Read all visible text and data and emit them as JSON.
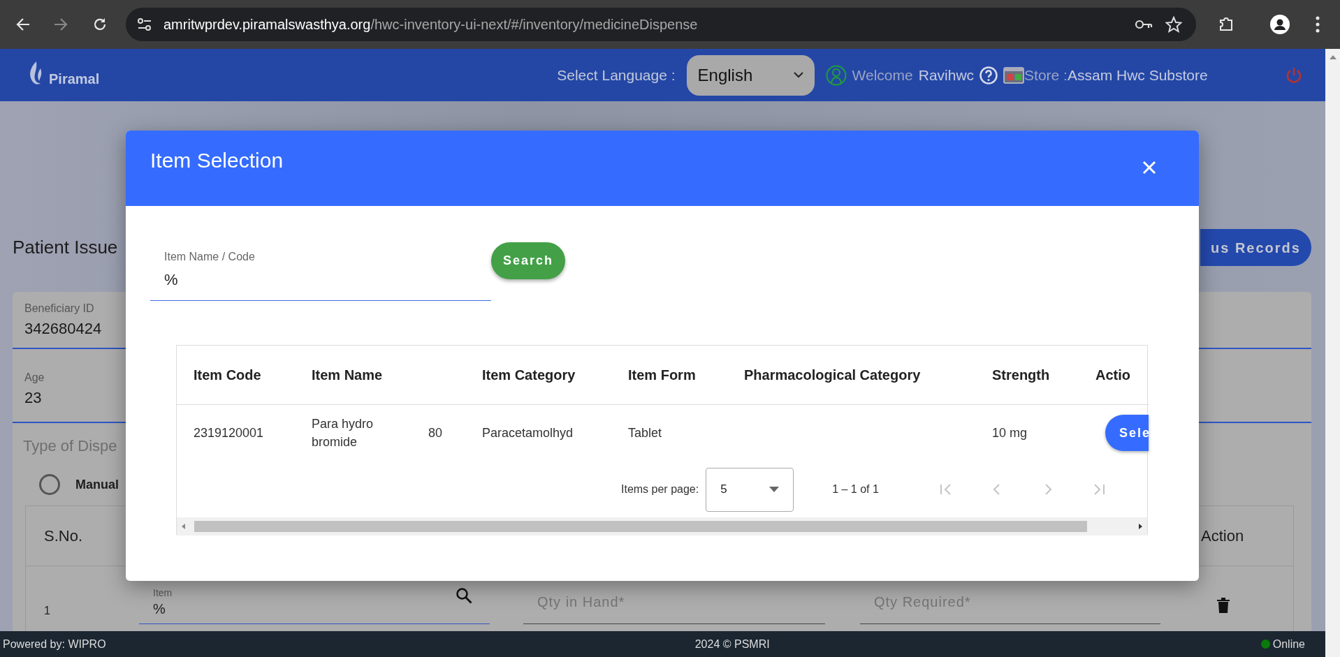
{
  "browser": {
    "url_host": "amritwprdev.piramalswasthya.org",
    "url_path": "/hwc-inventory-ui-next/#/inventory/medicineDispense"
  },
  "header": {
    "logo": "Piramal",
    "language_label": "Select Language :",
    "language": "English",
    "welcome": "Welcome",
    "user": "Ravihwc",
    "store_label": "Store :",
    "store": "Assam Hwc Substore"
  },
  "page": {
    "title": "Patient Issue",
    "records_button": "us Records",
    "fields": [
      {
        "label": "Beneficiary ID",
        "value": "342680424"
      },
      {
        "label": "Age",
        "value": "23"
      }
    ],
    "dispense_label": "Type of Dispe",
    "dispense_options": [
      {
        "label": "Manual",
        "selected": false
      }
    ],
    "table": {
      "columns": [
        "S.No.",
        "Action"
      ],
      "rows": [
        {
          "sno": "1",
          "item_label": "Item",
          "item_value": "%",
          "qty_in_hand_placeholder": "Qty in Hand*",
          "qty_required_placeholder": "Qty Required*"
        }
      ]
    }
  },
  "modal": {
    "title": "Item Selection",
    "search_field": {
      "label": "Item Name / Code",
      "value": "%"
    },
    "search_button": "Search",
    "table": {
      "columns": [
        {
          "label": "Item Code",
          "kind": "text"
        },
        {
          "label": "Item Name",
          "kind": "text"
        },
        {
          "kind": "text"
        },
        {
          "label": "Item Category",
          "kind": "text"
        },
        {
          "label": "Item Form",
          "kind": "text"
        },
        {
          "label": "Pharmacological Category",
          "kind": "text"
        },
        {
          "label": "Strength",
          "kind": "text"
        },
        {
          "label": "Actio",
          "kind": "button"
        }
      ],
      "rows": [
        {
          "cells": [
            "2319120001",
            "Para hydro bromide",
            "80",
            "Paracetamolhyd",
            "Tablet",
            null,
            "10 mg",
            "Sele"
          ]
        }
      ]
    },
    "paginator": {
      "label": "Items per page:",
      "page_size": "5",
      "range": "1 – 1 of 1",
      "buttons": [
        {
          "kind": "first",
          "disabled": true
        },
        {
          "kind": "previous",
          "disabled": true
        },
        {
          "kind": "next",
          "disabled": true
        },
        {
          "kind": "last",
          "disabled": true
        }
      ]
    }
  },
  "footer": {
    "left": "Powered by: WIPRO",
    "center": "2024 © PSMRI",
    "status": {
      "label": "Online",
      "online": true
    }
  }
}
